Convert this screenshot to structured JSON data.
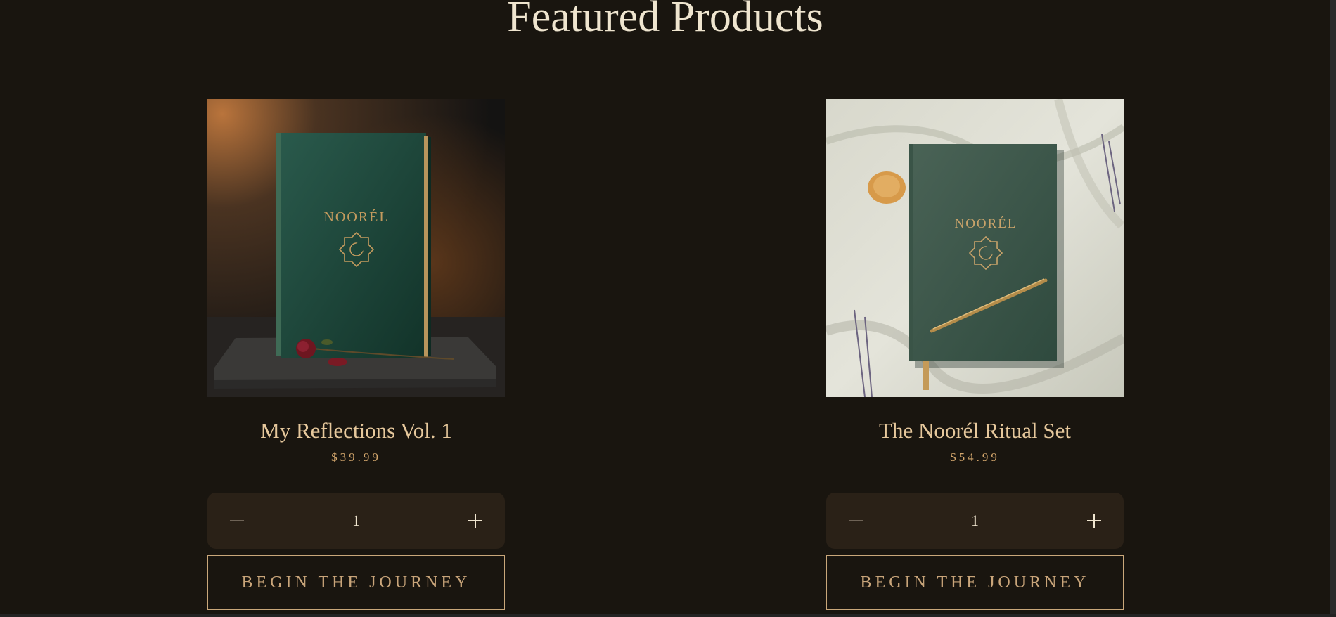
{
  "section": {
    "title": "Featured Products"
  },
  "products": [
    {
      "name": "My Reflections Vol. 1",
      "price": "$39.99",
      "quantity": "1",
      "cta_label": "BEGIN THE JOURNEY",
      "image_brand_text": "NOORÉL"
    },
    {
      "name": "The Noorél Ritual Set",
      "price": "$54.99",
      "quantity": "1",
      "cta_label": "BEGIN THE JOURNEY",
      "image_brand_text": "NOORÉL"
    }
  ],
  "icons": {
    "decrement": "minus-icon",
    "increment": "plus-icon"
  },
  "colors": {
    "background": "#19150f",
    "title": "#efe5cf",
    "product_name": "#e6c89c",
    "price": "#d3a66c",
    "stepper_bg": "#2a2117",
    "cta_border": "#c9a77a",
    "book_green": "#1e4a3e"
  }
}
